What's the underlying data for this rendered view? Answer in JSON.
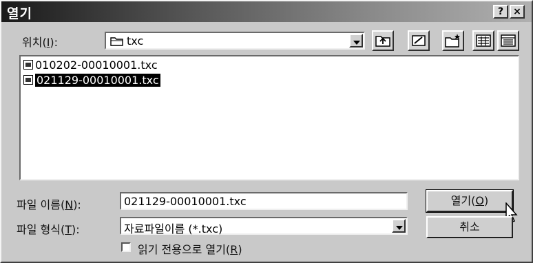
{
  "window": {
    "title": "열기",
    "help_label": "?",
    "close_label": "×"
  },
  "location": {
    "label": "위치(",
    "mnemonic": "I",
    "label_end": "):",
    "value": "txc"
  },
  "toolbar": {
    "icons": [
      "up-folder-icon",
      "desktop-icon",
      "new-folder-icon",
      "list-view-icon",
      "details-view-icon"
    ]
  },
  "files": [
    {
      "name": "010202-00010001.txc",
      "selected": false
    },
    {
      "name": "021129-00010001.txc",
      "selected": true
    }
  ],
  "filename": {
    "label": "파일 이름(",
    "mnemonic": "N",
    "label_end": "):",
    "value": "021129-00010001.txc"
  },
  "filetype": {
    "label": "파일 형식(",
    "mnemonic": "T",
    "label_end": "):",
    "value": "자료파일이름 (*.txc)"
  },
  "readonly": {
    "label": "읽기 전용으로 열기(",
    "mnemonic": "R",
    "label_end": ")",
    "checked": false
  },
  "buttons": {
    "open": "열기(",
    "open_mnemonic": "O",
    "open_end": ")",
    "cancel": "취소"
  }
}
